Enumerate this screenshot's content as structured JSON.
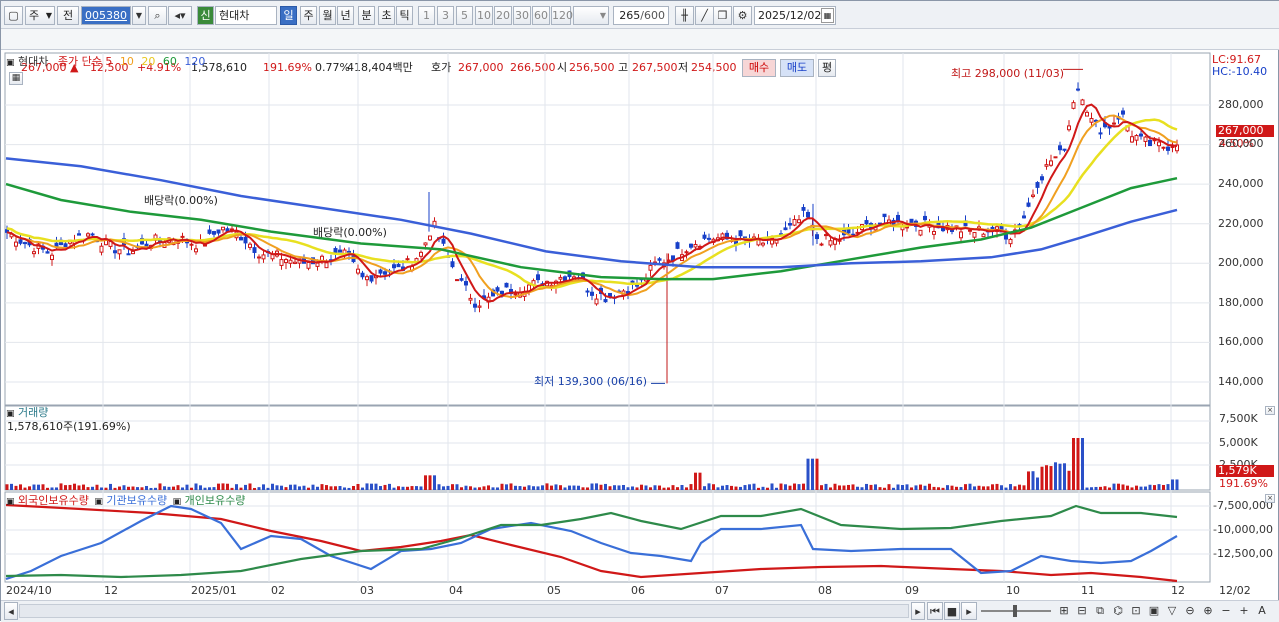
{
  "toolbar": {
    "period_label": "주",
    "prev_label": "전",
    "code_value": "005380",
    "new_badge": "신",
    "stock_name": "현대차",
    "periods": [
      "일",
      "주",
      "월",
      "년",
      "분",
      "초",
      "틱"
    ],
    "intervals": [
      "1",
      "3",
      "5",
      "10",
      "20",
      "30",
      "60",
      "120"
    ],
    "count_value": "265",
    "count_total": "/600",
    "date_value": "2025/12/02"
  },
  "quote": {
    "price": "267,000",
    "arrow": "▲",
    "change": "12,500",
    "change_pct": "+4.91%",
    "volume": "1,578,610",
    "volume_ratio": "191.69%",
    "turnover": "0.77%",
    "amount": "418,404백만",
    "bid_label": "호가",
    "ask_price": "267,000",
    "bid_price": "266,500",
    "open_label": "시",
    "open": "256,500",
    "high_label": "고",
    "high": "267,500",
    "low_label": "저",
    "low": "254,500",
    "buy_button": "매수",
    "sell_button": "매도",
    "eval_button": "평"
  },
  "price_panel": {
    "legend_name": "현대차",
    "legend_ma_label": "종가 단순",
    "ma_periods": [
      "5",
      "10",
      "20",
      "60",
      "120"
    ],
    "ma_colors": [
      "#d01818",
      "#f0a020",
      "#e8e020",
      "#1e9a3a",
      "#3a5fd8"
    ],
    "lc_label": "LC:91.67",
    "hc_label": "HC:-10.40",
    "high_note": "최고 298,000 (11/03)",
    "low_note": "최저 139,300 (06/16)",
    "dividend_notes": [
      "배당락(0.00%)",
      "배당락(0.00%)"
    ],
    "current_tag": "267,000",
    "current_pct": "4.50%",
    "y_ticks": [
      "280,000",
      "260,000",
      "240,000",
      "220,000",
      "200,000",
      "180,000",
      "160,000",
      "140,000"
    ]
  },
  "volume_panel": {
    "title": "거래량",
    "value_text": "1,578,610주(191.69%)",
    "y_ticks": [
      "7,500K",
      "5,000K",
      "2,500K"
    ],
    "current_tag": "1,579K",
    "current_pct": "191.69%"
  },
  "holdings_panel": {
    "legend": [
      "외국인보유수량",
      "기관보유수량",
      "개인보유수량"
    ],
    "legend_colors": [
      "#d01818",
      "#3a6fd8",
      "#2e8a4a"
    ],
    "y_ticks": [
      "-7,500,000",
      "-10,000,00",
      "-12,500,00"
    ]
  },
  "x_axis": [
    "2024/10",
    "12",
    "2025/01",
    "02",
    "03",
    "04",
    "05",
    "06",
    "07",
    "08",
    "09",
    "10",
    "11",
    "12",
    "12/02"
  ],
  "chart_data": {
    "type": "line",
    "title": "현대차",
    "x": [
      "2024/10",
      "12",
      "2025/01",
      "02",
      "03",
      "04",
      "05",
      "06",
      "07",
      "08",
      "09",
      "10",
      "11",
      "12"
    ],
    "series": [
      {
        "name": "종가",
        "values": [
          212000,
          210000,
          215000,
          205000,
          198000,
          215000,
          188000,
          185000,
          205000,
          212000,
          218000,
          222000,
          275000,
          265000
        ]
      },
      {
        "name": "5",
        "values": [
          210000,
          208000,
          213000,
          206000,
          199000,
          210000,
          190000,
          186000,
          206000,
          211000,
          218000,
          220000,
          270000,
          262000
        ]
      },
      {
        "name": "60",
        "values": [
          240000,
          228000,
          220000,
          210000,
          206000,
          205000,
          200000,
          193000,
          194000,
          200000,
          208000,
          215000,
          228000,
          243000
        ]
      },
      {
        "name": "120",
        "values": [
          253000,
          247000,
          238000,
          228000,
          222000,
          216000,
          208000,
          200000,
          198000,
          199000,
          201000,
          204000,
          212000,
          227000
        ]
      }
    ],
    "ylim": [
      130000,
      300000
    ],
    "annotations": [
      "최고 298,000 (11/03)",
      "최저 139,300 (06/16)"
    ]
  }
}
